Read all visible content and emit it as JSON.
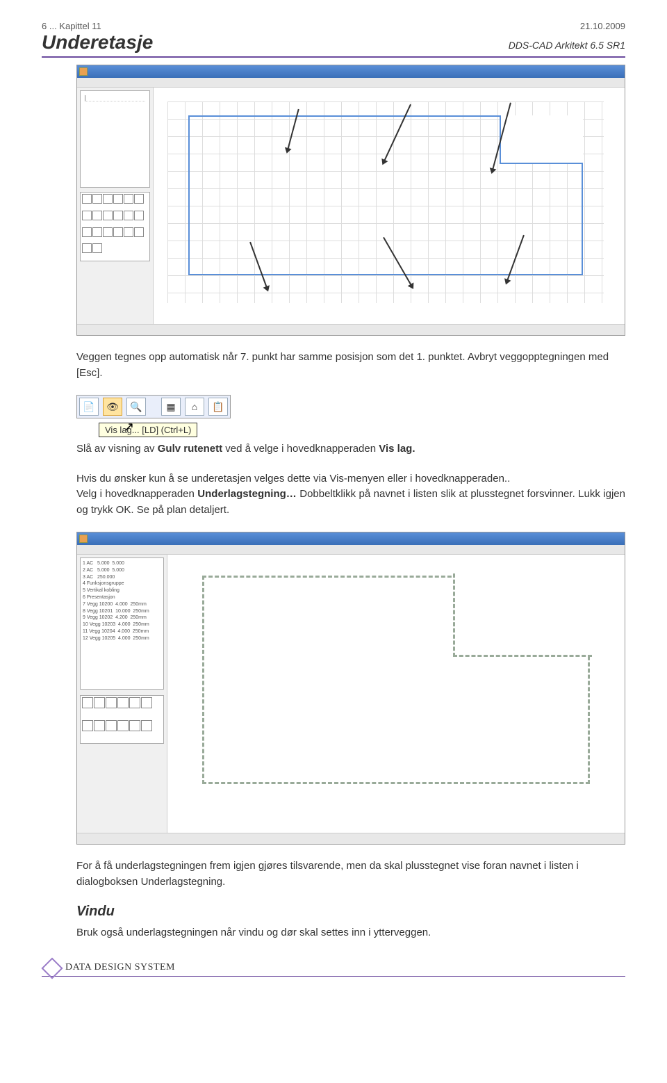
{
  "header": {
    "page_ref": "6 ... Kapittel 11",
    "date": "21.10.2009",
    "title": "Underetasje",
    "product": "DDS-CAD Arkitekt 6.5 SR1"
  },
  "text": {
    "p1_a": "Veggen tegnes opp automatisk når 7. punkt har samme posisjon som det 1. punktet. Avbryt veggopptegningen med [Esc].",
    "p2_a": "Slå av visning av ",
    "p2_bold1": "Gulv rutenett",
    "p2_b": " ved å velge i hovedknapperaden ",
    "p2_bold2": "Vis lag.",
    "p3_a": "Hvis du ønsker kun å se underetasjen velges dette via Vis-menyen eller i hovedknapperaden..",
    "p3_b": "Velg i hovedknapperaden ",
    "p3_bold1": "Underlagstegning…",
    "p3_c": " Dobbeltklikk på navnet i listen slik at plusstegnet forsvinner. Lukk igjen og trykk OK. Se på plan detaljert.",
    "p4": "For å få underlagstegningen frem igjen gjøres tilsvarende, men da skal plusstegnet vise foran navnet i listen i dialogboksen Underlagstegning.",
    "section_heading": "Vindu",
    "p5": "Bruk også underlagstegningen når vindu og dør skal settes inn i ytterveggen."
  },
  "toolbar": {
    "tooltip": "Vis lag... [LD] (Ctrl+L)"
  },
  "footer": {
    "company": "DATA DESIGN SYSTEM"
  }
}
